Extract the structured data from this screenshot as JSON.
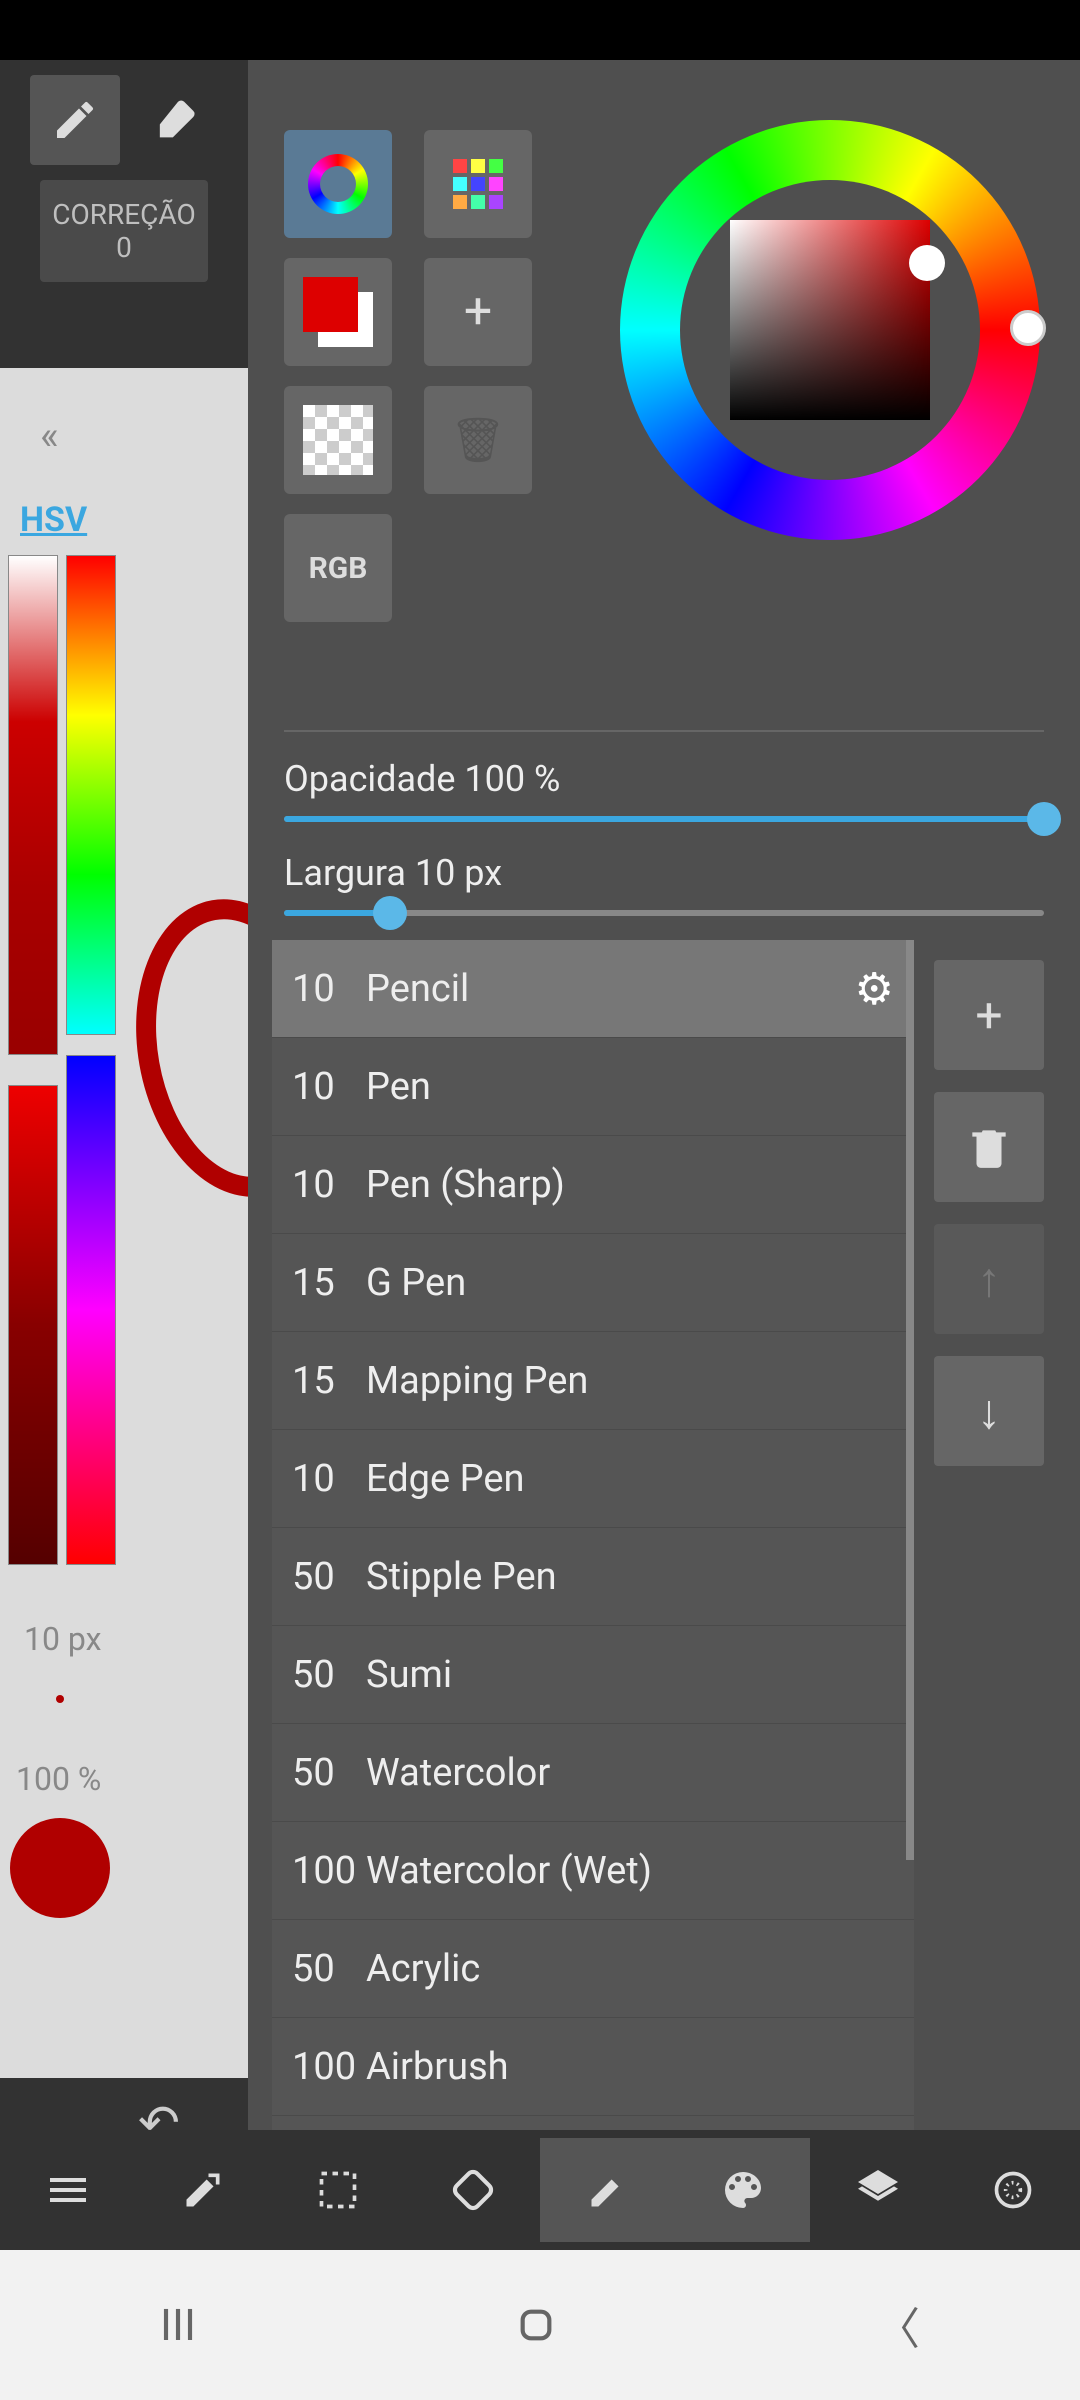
{
  "sidebar": {
    "correction_label": "CORREÇÃO",
    "correction_value": "0",
    "mode_label": "HSV",
    "size_label": "10 px",
    "opacity_label": "100 %",
    "swatch_color": "#b00000"
  },
  "color_panel": {
    "rgb_label": "RGB",
    "current_color": "#d00000",
    "secondary_color": "#ffffff"
  },
  "sliders": {
    "opacity": {
      "label": "Opacidade 100 %",
      "percent": 100
    },
    "width": {
      "label": "Largura 10 px",
      "percent": 14
    }
  },
  "brushes": {
    "selected_index": 0,
    "items": [
      {
        "size": "10",
        "name": "Pencil"
      },
      {
        "size": "10",
        "name": "Pen"
      },
      {
        "size": "10",
        "name": "Pen (Sharp)"
      },
      {
        "size": "15",
        "name": "G Pen"
      },
      {
        "size": "15",
        "name": "Mapping Pen"
      },
      {
        "size": "10",
        "name": "Edge Pen"
      },
      {
        "size": "50",
        "name": "Stipple Pen"
      },
      {
        "size": "50",
        "name": "Sumi"
      },
      {
        "size": "50",
        "name": "Watercolor"
      },
      {
        "size": "100",
        "name": "Watercolor (Wet)"
      },
      {
        "size": "50",
        "name": "Acrylic"
      },
      {
        "size": "100",
        "name": "Airbrush"
      }
    ]
  }
}
